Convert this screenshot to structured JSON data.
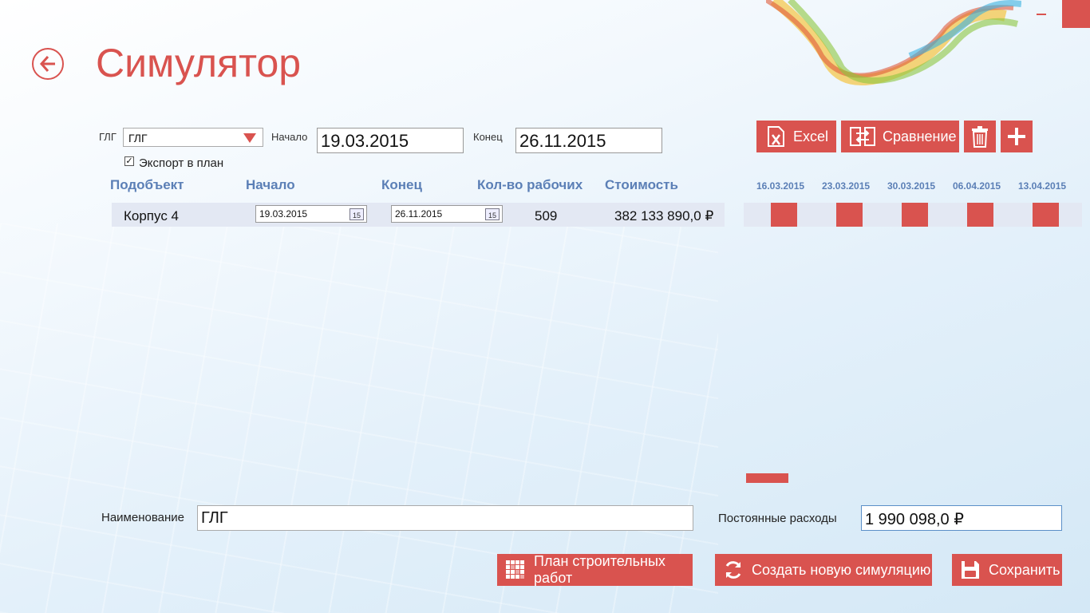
{
  "page": {
    "title": "Симулятор"
  },
  "filters": {
    "glg_label": "ГЛГ",
    "glg_value": "ГЛГ",
    "start_label": "Начало",
    "start_value": "19.03.2015",
    "end_label": "Конец",
    "end_value": "26.11.2015",
    "export_checked": true,
    "export_check_glyph": "✓",
    "export_label": "Экспорт в план"
  },
  "toolbar": {
    "excel_label": "Excel",
    "compare_label": "Сравнение",
    "delete_icon": "trash-icon",
    "add_icon": "plus-icon"
  },
  "table": {
    "headers": [
      "Подобъект",
      "Начало",
      "Конец",
      "Кол-во рабочих",
      "Стоимость"
    ],
    "rows": [
      {
        "subobject": "Корпус 4",
        "start": "19.03.2015",
        "end": "26.11.2015",
        "workers": "509",
        "cost": "382 133 890,0 ₽",
        "cal_icon_text": "15"
      }
    ]
  },
  "gantt": {
    "dates": [
      "16.03.2015",
      "23.03.2015",
      "30.03.2015",
      "06.04.2015",
      "13.04.2015"
    ],
    "bar_color": "#d9534f"
  },
  "form": {
    "name_label": "Наименование",
    "name_value": "ГЛГ",
    "fixed_costs_label": "Постоянные расходы",
    "fixed_costs_value": "1 990 098,0 ₽"
  },
  "actions": {
    "plan_label": "План строительных работ",
    "new_sim_label": "Создать новую симуляцию",
    "save_label": "Сохранить"
  },
  "colors": {
    "accent": "#d9534f",
    "header_blue": "#5b7fb6",
    "row_bg": "#e3e8f3"
  }
}
